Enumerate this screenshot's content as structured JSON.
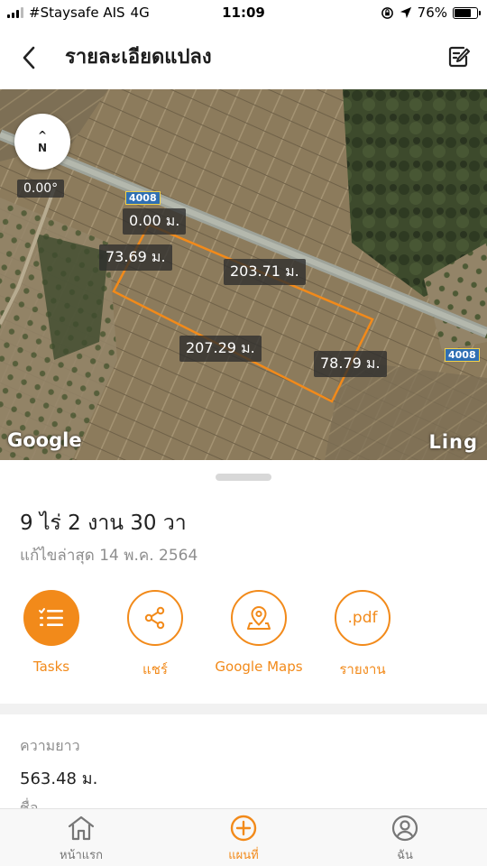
{
  "status_bar": {
    "carrier": "#Staysafe AIS",
    "network": "4G",
    "time": "11:09",
    "battery": "76%",
    "battery_level": 0.76
  },
  "header": {
    "title": "รายละเอียดแปลง",
    "icons": {
      "back": "back-arrow-icon",
      "edit": "edit-note-icon"
    }
  },
  "map": {
    "compass_symbol": "^",
    "compass_letter": "N",
    "rotation": "0.00°",
    "road_number_1": "4008",
    "road_number_2": "4008",
    "edge_labels": {
      "top": "0.00 ม.",
      "left": "73.69 ม.",
      "upper": "203.71 ม.",
      "lower": "207.29 ม.",
      "right": "78.79 ม."
    },
    "provider_logo": "Google",
    "app_logo": "Ling",
    "plot_outline_color": "#f28a1a"
  },
  "plot": {
    "area": "9 ไร่ 2 งาน 30 วา",
    "last_edited": "แก้ไขล่าสุด 14 พ.ค. 2564"
  },
  "actions": [
    {
      "label": "Tasks",
      "icon": "task-list-icon"
    },
    {
      "label": "แชร์",
      "icon": "share-icon"
    },
    {
      "label": "Google Maps",
      "icon": "map-pin-icon"
    },
    {
      "label": "รายงาน",
      "icon": "pdf-icon",
      "icon_text": ".pdf"
    }
  ],
  "details": {
    "length_label": "ความยาว",
    "length_value": "563.48 ม."
  },
  "bottom_nav": [
    {
      "label": "หน้าแรก",
      "icon": "home-icon",
      "active": false
    },
    {
      "label": "แผนที่",
      "icon": "add-circle-icon",
      "active": true
    },
    {
      "label": "ฉัน",
      "icon": "user-icon",
      "active": false
    }
  ],
  "colors": {
    "accent": "#f28a1a",
    "text_primary": "#222222",
    "text_secondary": "#8e8e8e"
  }
}
